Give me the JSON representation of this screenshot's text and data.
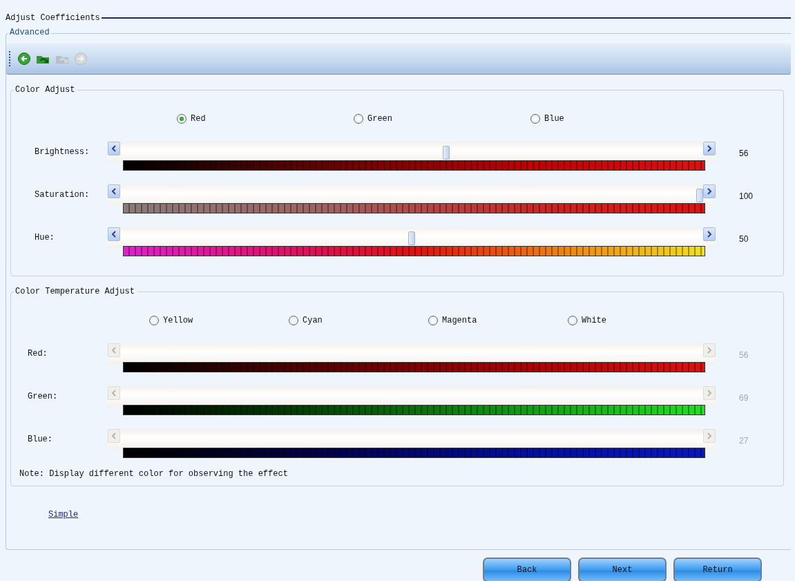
{
  "header": {
    "title": "Adjust Coefficients"
  },
  "panel": {
    "legend": "Advanced"
  },
  "toolbar": [
    {
      "kind": "back",
      "disabled": false
    },
    {
      "kind": "undo",
      "disabled": false
    },
    {
      "kind": "redo",
      "disabled": true
    },
    {
      "kind": "forward",
      "disabled": true
    }
  ],
  "color_adjust": {
    "title": "Color Adjust",
    "options": [
      {
        "label": "Red",
        "selected": true
      },
      {
        "label": "Green",
        "selected": false
      },
      {
        "label": "Blue",
        "selected": false
      }
    ],
    "sliders": [
      {
        "label": "Brightness:",
        "kind": "brightness",
        "level": 0.56,
        "value": "56",
        "disabled": false
      },
      {
        "label": "Saturation:",
        "kind": "saturation",
        "level": 1,
        "value": "100",
        "disabled": false
      },
      {
        "label": "Hue:",
        "kind": "hue",
        "level": 0.5,
        "value": "50",
        "disabled": false
      }
    ]
  },
  "color_temperature": {
    "title": "Color Temperature Adjust",
    "options": [
      {
        "label": "Yellow",
        "selected": false
      },
      {
        "label": "Cyan",
        "selected": false
      },
      {
        "label": "Magenta",
        "selected": false
      },
      {
        "label": "White",
        "selected": false
      }
    ],
    "sliders": [
      {
        "label": "Red:",
        "kind": "red",
        "value": "56",
        "disabled": true
      },
      {
        "label": "Green:",
        "kind": "green",
        "value": "69",
        "disabled": true
      },
      {
        "label": "Blue:",
        "kind": "blue",
        "value": "27",
        "disabled": true
      }
    ],
    "note": "Note: Display different color for observing the effect"
  },
  "link": "Simple",
  "buttons": [
    "Back",
    "Next",
    "Return"
  ]
}
